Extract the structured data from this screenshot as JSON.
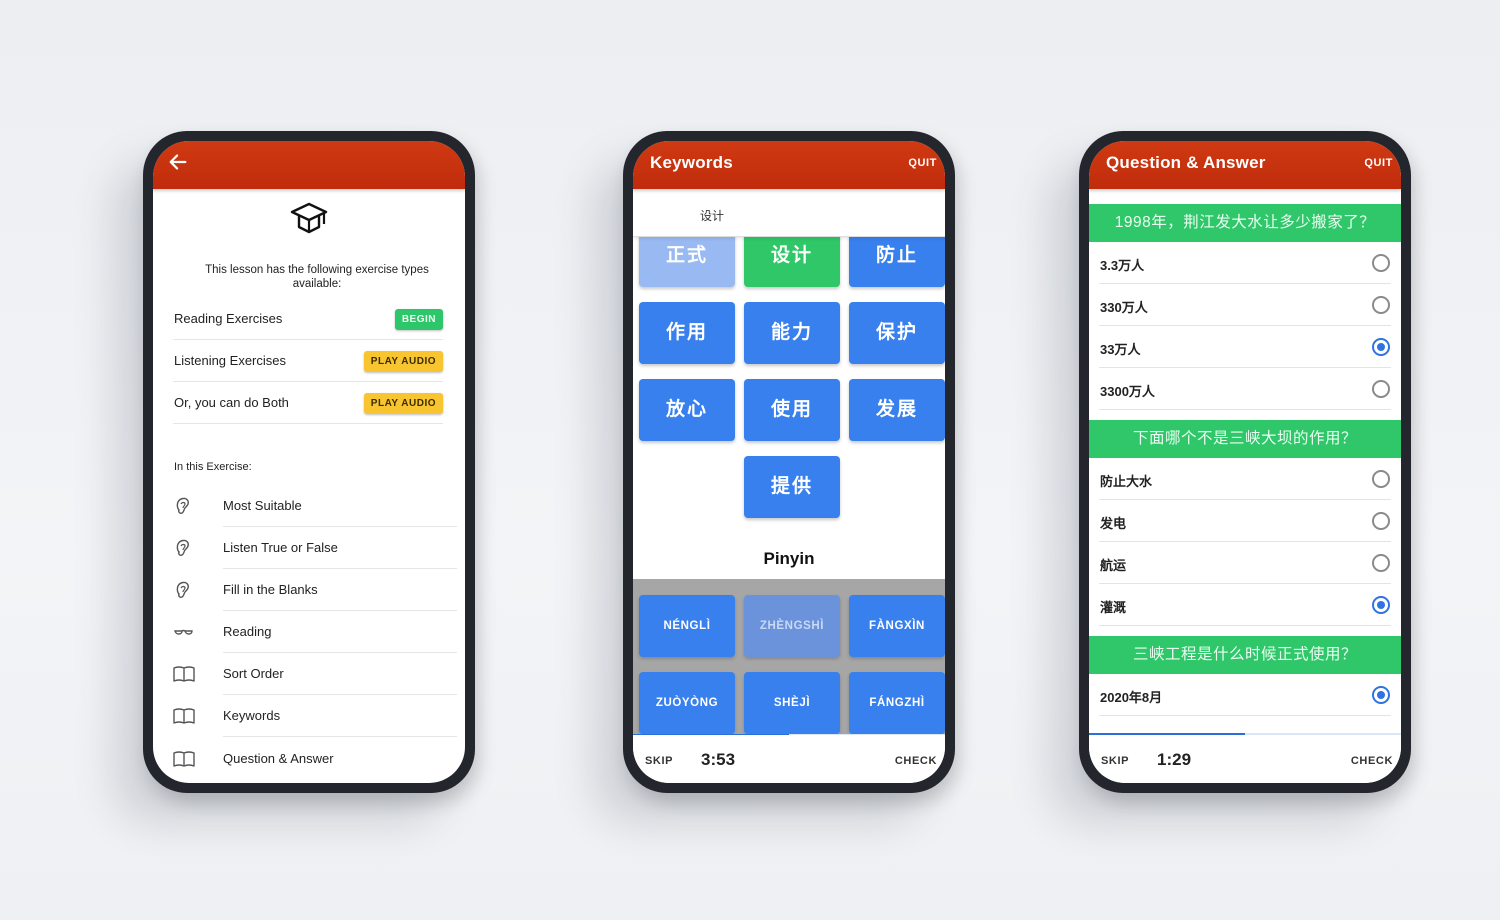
{
  "phones": [
    {
      "id": "lesson-overview",
      "appbar": {
        "back_icon": "arrow-left-icon"
      },
      "header_icon": "graduation-cap-icon",
      "intro_text": "This lesson has the following exercise types available:",
      "exercise_types": [
        {
          "label": "Reading Exercises",
          "action": "BEGIN",
          "action_color": "#2ec66a"
        },
        {
          "label": "Listening Exercises",
          "action": "PLAY AUDIO",
          "action_color": "#f8c531"
        },
        {
          "label": "Or, you can do Both",
          "action": "PLAY AUDIO",
          "action_color": "#f8c531"
        }
      ],
      "section_label": "In this Exercise:",
      "exercises": [
        {
          "label": "Most Suitable",
          "icon": "ear-icon"
        },
        {
          "label": "Listen True or False",
          "icon": "ear-icon"
        },
        {
          "label": "Fill in the Blanks",
          "icon": "ear-icon"
        },
        {
          "label": "Reading",
          "icon": "glasses-icon"
        },
        {
          "label": "Sort Order",
          "icon": "book-icon"
        },
        {
          "label": "Keywords",
          "icon": "book-icon"
        },
        {
          "label": "Question & Answer",
          "icon": "book-icon"
        }
      ]
    },
    {
      "id": "keywords",
      "appbar": {
        "title": "Keywords",
        "quit": "QUIT"
      },
      "current_word": "设计",
      "word_tiles": [
        {
          "text": "正式",
          "state": "used"
        },
        {
          "text": "设计",
          "state": "correct"
        },
        {
          "text": "防止",
          "state": "default"
        },
        {
          "text": "作用",
          "state": "default"
        },
        {
          "text": "能力",
          "state": "default"
        },
        {
          "text": "保护",
          "state": "default"
        },
        {
          "text": "放心",
          "state": "default"
        },
        {
          "text": "使用",
          "state": "default"
        },
        {
          "text": "发展",
          "state": "default"
        },
        {
          "text": "提供",
          "state": "default"
        }
      ],
      "pinyin_title": "Pinyin",
      "pinyin_tiles": [
        {
          "text": "NÉNGLÌ",
          "state": "default"
        },
        {
          "text": "ZHÈNGSHÌ",
          "state": "used"
        },
        {
          "text": "FÀNGXÌN",
          "state": "default"
        },
        {
          "text": "ZUÒYÒNG",
          "state": "default"
        },
        {
          "text": "SHÈJÌ",
          "state": "default"
        },
        {
          "text": "FÁNGZHÌ",
          "state": "default"
        }
      ],
      "progress": 0.5,
      "footer": {
        "skip": "SKIP",
        "timer": "3:53",
        "check": "CHECK"
      }
    },
    {
      "id": "question-answer",
      "appbar": {
        "title": "Question & Answer",
        "quit": "QUIT"
      },
      "questions": [
        {
          "question": "1998年，荆江发大水让多少搬家了？",
          "options": [
            {
              "text": "3.3万人",
              "selected": false
            },
            {
              "text": "330万人",
              "selected": false
            },
            {
              "text": "33万人",
              "selected": true
            },
            {
              "text": "3300万人",
              "selected": false
            }
          ]
        },
        {
          "question": "下面哪个不是三峡大坝的作用？",
          "options": [
            {
              "text": "防止大水",
              "selected": false
            },
            {
              "text": "发电",
              "selected": false
            },
            {
              "text": "航运",
              "selected": false
            },
            {
              "text": "灌溉",
              "selected": true
            }
          ]
        },
        {
          "question": "三峡工程是什么时候正式使用？",
          "options": [
            {
              "text": "2020年8月",
              "selected": true
            }
          ]
        }
      ],
      "progress": 0.5,
      "footer": {
        "skip": "SKIP",
        "timer": "1:29",
        "check": "CHECK"
      }
    }
  ],
  "colors": {
    "appbar": "#c8320f",
    "tile_blue": "#3880ee",
    "tile_green": "#2fc767",
    "radio_selected": "#2f73e0"
  }
}
